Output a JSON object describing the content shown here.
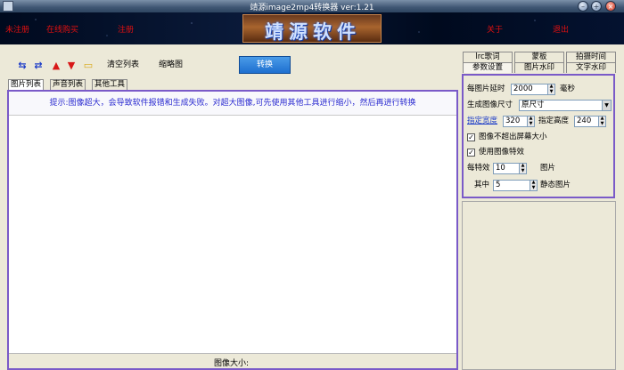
{
  "window": {
    "title": "靖源image2mp4转换器 ver:1.21",
    "min_icon": "minimize-icon",
    "max_icon": "maximize-icon",
    "close_icon": "close-icon"
  },
  "banner": {
    "links": [
      "未注册",
      "在线购买",
      "注册",
      "关于",
      "退出"
    ],
    "logo_text": "靖源软件"
  },
  "toolbar": {
    "icons": [
      "add-images-icon",
      "add-folder-icon",
      "move-up-icon",
      "move-down-icon",
      "open-folder-icon"
    ],
    "clear_list": "清空列表",
    "thumbnail": "缩略图",
    "convert": "转换"
  },
  "left_tabs": [
    "图片列表",
    "声音列表",
    "其他工具"
  ],
  "hint": "提示:图像超大，会导致软件报错和生成失败。对超大图像,可先使用其他工具进行缩小，然后再进行转换",
  "status": {
    "image_size_label": "图像大小:"
  },
  "right_tabs": {
    "row1": [
      "lrc歌词",
      "蒙板",
      "拍摄时间"
    ],
    "row2": [
      "参数设置",
      "图片水印",
      "文字水印"
    ]
  },
  "settings": {
    "delay_label": "每图片延时",
    "delay_value": "2000",
    "delay_unit": "毫秒",
    "size_label": "生成图像尺寸",
    "size_value": "原尺寸",
    "width_label": "指定宽度",
    "width_value": "320",
    "height_label": "指定高度",
    "height_value": "240",
    "no_exceed_label": "图像不超出屏幕大小",
    "no_exceed_checked": true,
    "use_effect_label": "使用图像特效",
    "use_effect_checked": true,
    "per_effect_label": "每特效",
    "per_effect_value": "10",
    "per_effect_unit": "图片",
    "among_label": "其中",
    "among_value": "5",
    "static_label": "静态图片"
  },
  "colors": {
    "accent_border": "#7a5ac8",
    "link_red": "#e01010",
    "hint_blue": "#2a2ad0",
    "convert_button": "#1e6fd0"
  }
}
